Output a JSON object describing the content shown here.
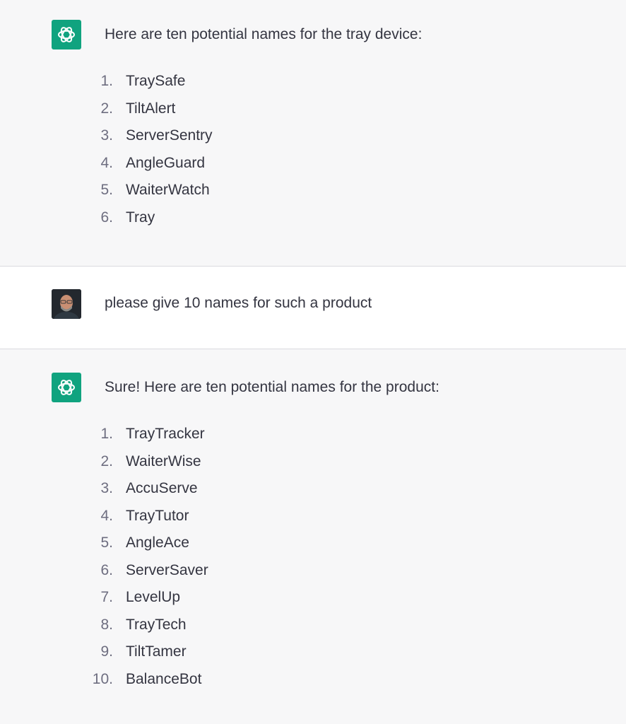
{
  "messages": [
    {
      "role": "assistant",
      "intro": "Here are ten potential names for the tray device:",
      "items": [
        {
          "num": "1.",
          "text": "TraySafe"
        },
        {
          "num": "2.",
          "text": "TiltAlert"
        },
        {
          "num": "3.",
          "text": "ServerSentry"
        },
        {
          "num": "4.",
          "text": "AngleGuard"
        },
        {
          "num": "5.",
          "text": "WaiterWatch"
        },
        {
          "num": "6.",
          "text": "Tray"
        }
      ]
    },
    {
      "role": "user",
      "text": "please give 10 names for such a product"
    },
    {
      "role": "assistant",
      "intro": "Sure! Here are ten potential names for the product:",
      "items": [
        {
          "num": "1.",
          "text": "TrayTracker"
        },
        {
          "num": "2.",
          "text": "WaiterWise"
        },
        {
          "num": "3.",
          "text": "AccuServe"
        },
        {
          "num": "4.",
          "text": "TrayTutor"
        },
        {
          "num": "5.",
          "text": "AngleAce"
        },
        {
          "num": "6.",
          "text": "ServerSaver"
        },
        {
          "num": "7.",
          "text": "LevelUp"
        },
        {
          "num": "8.",
          "text": "TrayTech"
        },
        {
          "num": "9.",
          "text": "TiltTamer"
        },
        {
          "num": "10.",
          "text": "BalanceBot"
        }
      ]
    }
  ],
  "colors": {
    "assistant_bg": "#f7f7f8",
    "user_bg": "#ffffff",
    "bot_avatar": "#10a37f",
    "text": "#343541",
    "list_number": "#6e6e80"
  },
  "icons": {
    "assistant_avatar": "openai-logo-icon",
    "user_avatar": "user-photo-avatar"
  }
}
